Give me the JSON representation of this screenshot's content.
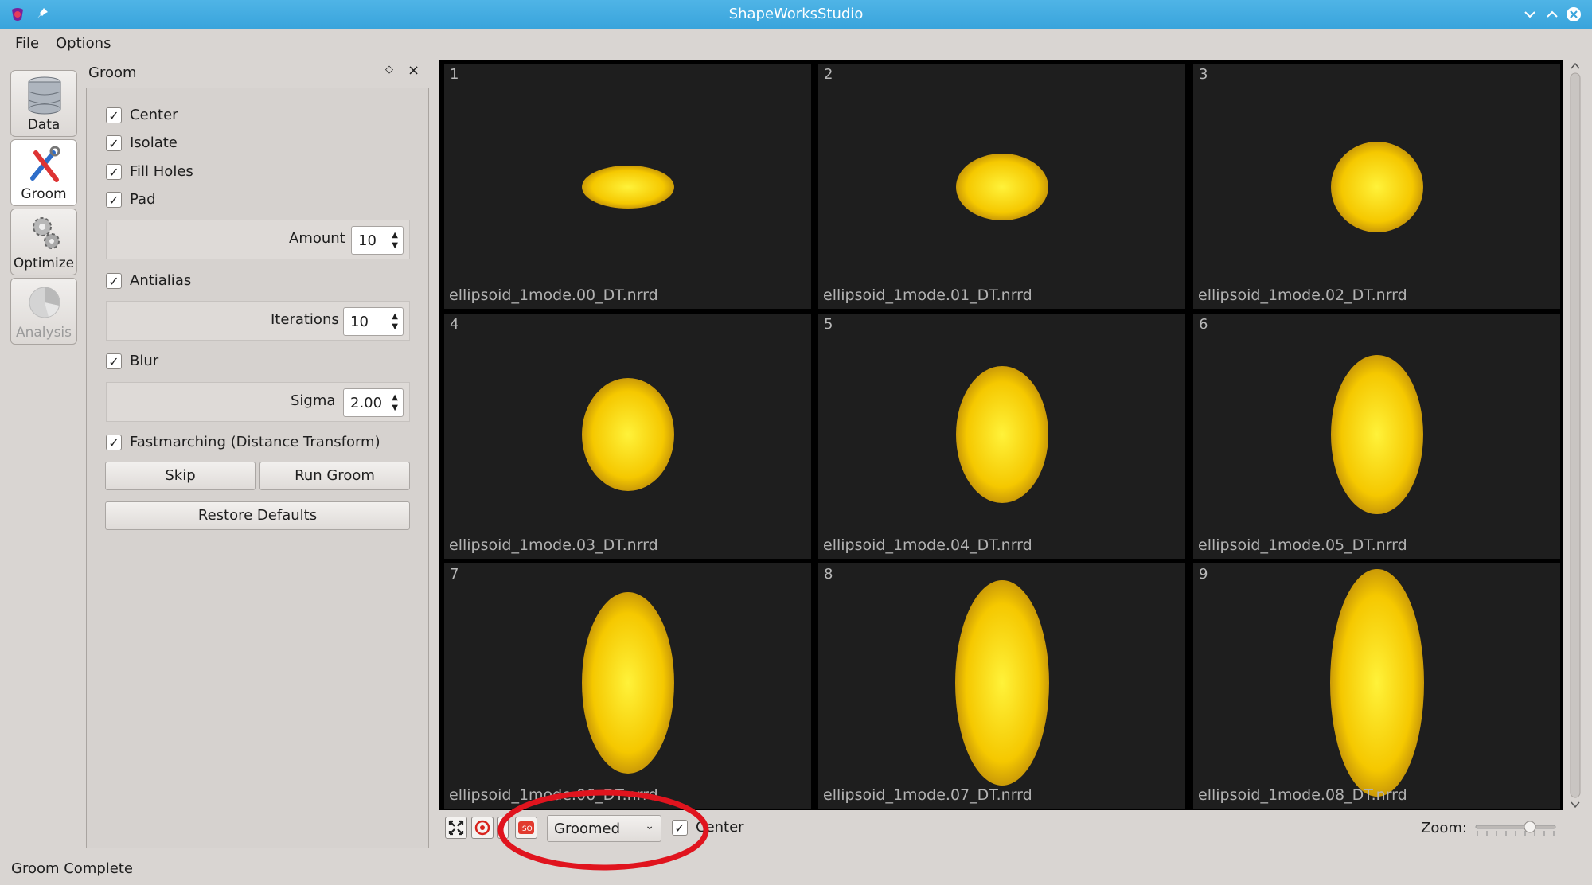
{
  "window": {
    "title": "ShapeWorksStudio"
  },
  "menu": {
    "items": [
      "File",
      "Options"
    ]
  },
  "toolbar": {
    "items": [
      {
        "label": "Data",
        "icon": "database-icon"
      },
      {
        "label": "Groom",
        "icon": "brush-wrench-icon"
      },
      {
        "label": "Optimize",
        "icon": "gears-icon"
      },
      {
        "label": "Analysis",
        "icon": "pie-chart-icon"
      }
    ]
  },
  "groom": {
    "title": "Groom",
    "center": "Center",
    "isolate": "Isolate",
    "fill_holes": "Fill Holes",
    "pad": "Pad",
    "amount_label": "Amount",
    "amount_value": "10",
    "antialias": "Antialias",
    "iterations_label": "Iterations",
    "iterations_value": "10",
    "blur": "Blur",
    "sigma_label": "Sigma",
    "sigma_value": "2.00",
    "fastmarching": "Fastmarching (Distance Transform)",
    "skip_button": "Skip",
    "run_button": "Run Groom",
    "restore_button": "Restore Defaults"
  },
  "viewer": {
    "cells": [
      {
        "num": "1",
        "file": "ellipsoid_1mode.00_DT.nrrd"
      },
      {
        "num": "2",
        "file": "ellipsoid_1mode.01_DT.nrrd"
      },
      {
        "num": "3",
        "file": "ellipsoid_1mode.02_DT.nrrd"
      },
      {
        "num": "4",
        "file": "ellipsoid_1mode.03_DT.nrrd"
      },
      {
        "num": "5",
        "file": "ellipsoid_1mode.04_DT.nrrd"
      },
      {
        "num": "6",
        "file": "ellipsoid_1mode.05_DT.nrrd"
      },
      {
        "num": "7",
        "file": "ellipsoid_1mode.06_DT.nrrd"
      },
      {
        "num": "8",
        "file": "ellipsoid_1mode.07_DT.nrrd"
      },
      {
        "num": "9",
        "file": "ellipsoid_1mode.08_DT.nrrd"
      }
    ],
    "shape_color": "#f5c800",
    "background": "#1e1e1e"
  },
  "view_toolbar": {
    "display_mode": "Groomed",
    "center_label": "Center",
    "zoom_label": "Zoom:",
    "iso_label": "ISO"
  },
  "status": {
    "text": "Groom Complete"
  },
  "annotation": {
    "color": "#e0141e"
  }
}
